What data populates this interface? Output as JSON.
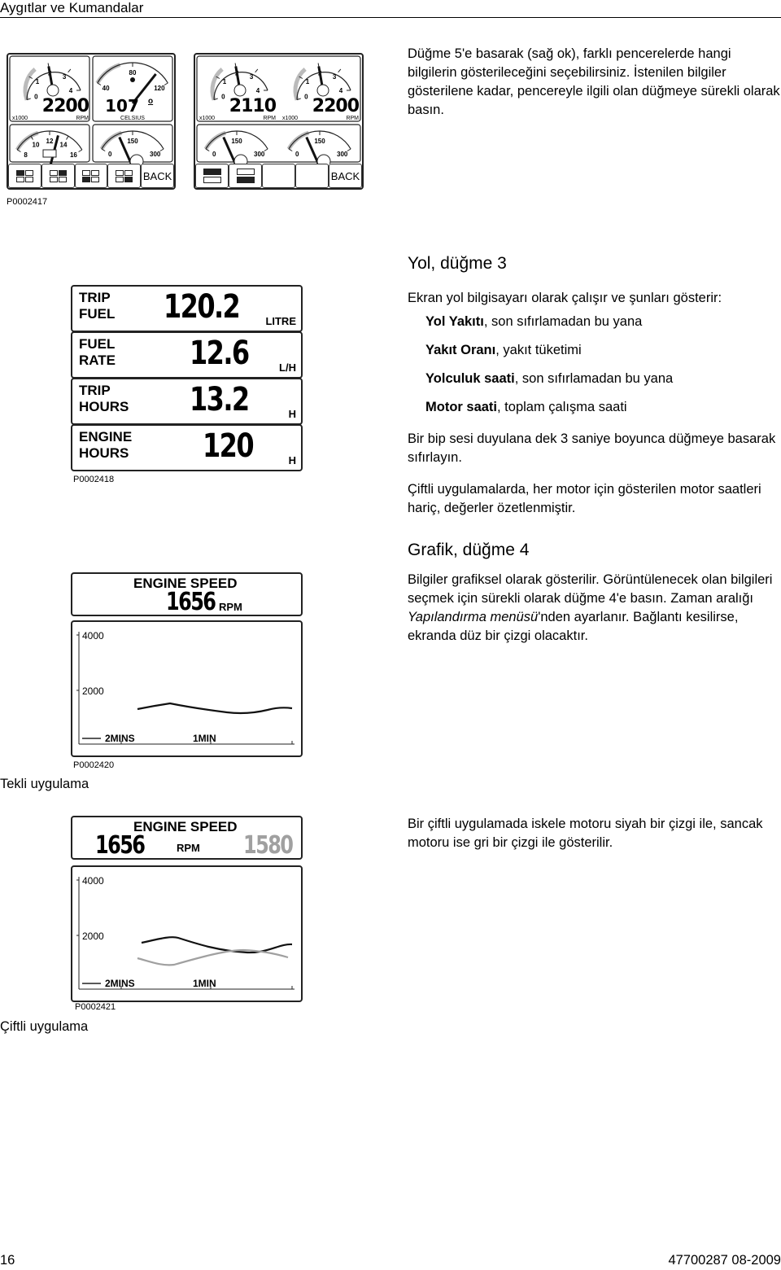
{
  "header": {
    "title": "Aygıtlar ve Kumandalar"
  },
  "intro": "Düğme 5'e basarak (sağ ok), farklı pencerelerde hangi bilgilerin gösterileceğini seçebilirsiniz. İstenilen bilgiler gösterilene kadar, pencereyle ilgili olan düğmeye sürekli olarak basın.",
  "figure1": {
    "caption": "P0002417",
    "left": {
      "rpm": {
        "ticks": [
          "0",
          "1",
          "2",
          "3",
          "4"
        ],
        "value": "2200",
        "unit": "RPM",
        "mult": "x1000"
      },
      "temp": {
        "ticks": [
          "40",
          "80",
          "120"
        ],
        "value": "107",
        "deg": "o",
        "unit": "CELSIUS"
      },
      "volt": {
        "ticks": [
          "8",
          "10",
          "12",
          "14",
          "16"
        ]
      },
      "oil": {
        "ticks": [
          "0",
          "150",
          "300"
        ]
      },
      "back": "BACK"
    },
    "right": {
      "rpm1": {
        "ticks": [
          "0",
          "1",
          "2",
          "3",
          "4"
        ],
        "value": "2110",
        "unit": "RPM",
        "mult": "x1000"
      },
      "rpm2": {
        "ticks": [
          "0",
          "1",
          "2",
          "3",
          "4"
        ],
        "value": "2200",
        "unit": "RPM",
        "mult": "x1000"
      },
      "oil_ticks": [
        "0",
        "150",
        "300"
      ],
      "back": "BACK"
    }
  },
  "trip": {
    "heading": "Yol, düğme 3",
    "intro": "Ekran yol bilgisayarı olarak çalışır ve şunları gösterir:",
    "items": [
      {
        "b": "Yol Yakıtı",
        "t": ", son sıfırlamadan bu yana"
      },
      {
        "b": "Yakıt Oranı",
        "t": ", yakıt tüketimi"
      },
      {
        "b": "Yolculuk saati",
        "t": ", son sıfırlamadan bu yana"
      },
      {
        "b": "Motor saati",
        "t": ", toplam çalışma saati"
      }
    ],
    "p1": "Bir bip sesi duyulana dek 3 saniye boyunca düğmeye basarak sıfırlayın.",
    "p2": "Çiftli uygulamalarda, her motor için gösterilen motor saatleri hariç, değerler özetlenmiştir.",
    "display": [
      {
        "l1": "TRIP",
        "l2": "FUEL",
        "value": "120.2",
        "unit": "LITRE"
      },
      {
        "l1": "FUEL",
        "l2": "RATE",
        "value": "12.6",
        "unit": "L/H"
      },
      {
        "l1": "TRIP",
        "l2": "HOURS",
        "value": "13.2",
        "unit": "H"
      },
      {
        "l1": "ENGINE",
        "l2": "HOURS",
        "value": "120",
        "unit": "H"
      }
    ],
    "caption": "P0002418"
  },
  "graph": {
    "heading": "Grafik, düğme 4",
    "p1a": "Bilgiler grafiksel olarak gösterilir. Görüntülenecek olan bilgileri seçmek için sürekli olarak düğme 4'e basın. Zaman aralığı ",
    "p1i": "Yapılandırma menüsü",
    "p1b": "'nden ayarlanır. Bağlantı kesilirse, ekranda düz bir çizgi olacaktır.",
    "single": {
      "title": "ENGINE SPEED",
      "value": "1656",
      "unit": "RPM",
      "y_ticks": [
        "4000",
        "2000"
      ],
      "x_ticks": [
        "2MINS",
        "1MIN"
      ],
      "caption": "P0002420",
      "label": "Tekli uygulama"
    },
    "twin": {
      "title": "ENGINE SPEED",
      "value_port": "1656",
      "unit": "RPM",
      "value_stbd": "1580",
      "y_ticks": [
        "4000",
        "2000"
      ],
      "x_ticks": [
        "2MINS",
        "1MIN"
      ],
      "caption": "P0002421",
      "label": "Çiftli uygulama",
      "stbd_color": "#a0a0a0"
    },
    "twin_text": "Bir çiftli uygulamada iskele motoru siyah bir çizgi ile, sancak motoru ise gri bir çizgi ile gösterilir."
  },
  "footer": {
    "page": "16",
    "doc": "47700287 08-2009"
  }
}
